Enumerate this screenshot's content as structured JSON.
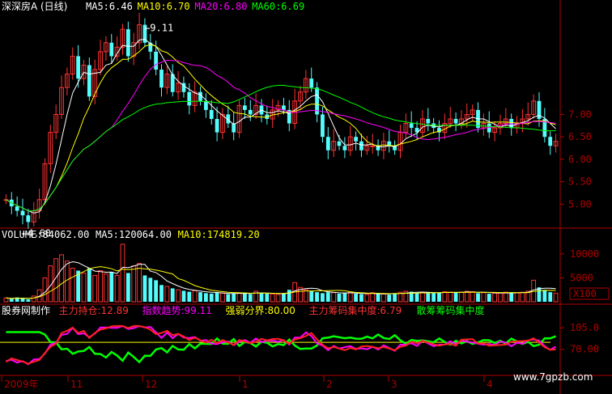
{
  "header": {
    "title": "深深房A",
    "period": "(日线)",
    "ma_items": [
      {
        "label": "MA5:6.46",
        "color": "#ffffff"
      },
      {
        "label": "MA10:6.70",
        "color": "#ffff00"
      },
      {
        "label": "MA20:6.80",
        "color": "#ff00ff"
      },
      {
        "label": "MA60:6.69",
        "color": "#00ff00"
      }
    ]
  },
  "price_panel": {
    "max_label": "9.11",
    "min_label": "4.60",
    "y_ticks": [
      "7.00",
      "6.50",
      "6.00",
      "5.50",
      "5.00"
    ]
  },
  "volume_panel": {
    "items": [
      {
        "label": "VOLUME:84062.00",
        "color": "#ffffff"
      },
      {
        "label": "MA5:120064.00",
        "color": "#ffffff"
      },
      {
        "label": "MA10:174819.20",
        "color": "#ffff00"
      }
    ],
    "y_ticks": [
      "10000",
      "5000"
    ],
    "unit": "X100"
  },
  "indicator_panel": {
    "items": [
      {
        "label": "股券网制作",
        "color": "#ffffff"
      },
      {
        "label": "主力持仓:12.89",
        "color": "#ff3333"
      },
      {
        "label": "指数趋势:99.11",
        "color": "#ff00ff"
      },
      {
        "label": "强弱分界:80.00",
        "color": "#ffff00"
      },
      {
        "label": "主力筹码集中度:6.79",
        "color": "#ff3333"
      },
      {
        "label": "散筹筹码集中度",
        "color": "#00ff00"
      }
    ],
    "y_ticks": [
      "105.0",
      "70.00"
    ]
  },
  "x_axis": {
    "labels": [
      "2009年",
      "11",
      "12",
      "1",
      "2",
      "3",
      "4"
    ]
  },
  "watermark": "www.7gpzb.com",
  "colors": {
    "up": "#ff3333",
    "down": "#54fcfc",
    "grid": "#b00000",
    "ma5": "#ffffff",
    "ma10": "#ffff00",
    "ma20": "#ff00ff",
    "ma60": "#00ff00"
  },
  "chart_data": {
    "type": "candlestick",
    "price_ylim": [
      4.5,
      9.3
    ],
    "closes": [
      5.1,
      4.95,
      4.85,
      4.75,
      4.6,
      4.85,
      5.1,
      5.9,
      6.6,
      7.0,
      7.6,
      7.9,
      8.3,
      7.8,
      8.1,
      7.4,
      8.0,
      8.4,
      8.6,
      8.3,
      8.5,
      8.9,
      8.3,
      8.6,
      9.0,
      8.6,
      8.4,
      8.0,
      7.6,
      7.9,
      7.5,
      7.7,
      7.5,
      7.2,
      7.5,
      7.3,
      7.1,
      6.9,
      6.6,
      7.0,
      6.8,
      6.6,
      7.2,
      7.1,
      7.0,
      7.2,
      7.0,
      6.9,
      7.1,
      7.2,
      7.1,
      6.8,
      7.3,
      7.5,
      7.8,
      7.6,
      7.0,
      6.5,
      6.2,
      6.4,
      6.3,
      6.2,
      6.5,
      6.4,
      6.2,
      6.3,
      6.3,
      6.2,
      6.4,
      6.3,
      6.2,
      6.6,
      6.8,
      6.7,
      6.6,
      6.9,
      6.8,
      6.7,
      6.6,
      6.8,
      6.9,
      6.8,
      6.9,
      7.0,
      7.1,
      6.7,
      6.8,
      6.6,
      6.7,
      6.8,
      6.9,
      6.7,
      6.8,
      6.9,
      7.0,
      7.3,
      6.9,
      6.5,
      6.3,
      6.4
    ],
    "volume_ylim": [
      0,
      13000
    ],
    "volumes": [
      800,
      600,
      900,
      700,
      500,
      1200,
      2500,
      5000,
      7500,
      9000,
      9800,
      8500,
      7000,
      6500,
      6000,
      7000,
      5500,
      6500,
      5800,
      6200,
      5500,
      12000,
      6000,
      7500,
      8000,
      5500,
      5000,
      4500,
      3500,
      3200,
      2800,
      2500,
      2300,
      2100,
      2300,
      2000,
      1800,
      1700,
      1900,
      1800,
      1600,
      1700,
      1900,
      1800,
      1600,
      2200,
      1800,
      1700,
      1600,
      1500,
      1800,
      2500,
      4000,
      3000,
      2500,
      2200,
      2000,
      1800,
      2000,
      1900,
      1700,
      1800,
      2000,
      1700,
      1600,
      1500,
      1900,
      1700,
      1600,
      1500,
      1800,
      2000,
      2200,
      2100,
      1800,
      2000,
      1900,
      1800,
      1900,
      2100,
      2000,
      1900,
      2000,
      2200,
      2100,
      1800,
      1900,
      1700,
      1800,
      1900,
      2000,
      1800,
      1900,
      2000,
      2200,
      4500,
      3000,
      2500,
      2000,
      1800
    ],
    "indicator_ylim": [
      30,
      125
    ],
    "line_strength_boundary": 80.0
  }
}
